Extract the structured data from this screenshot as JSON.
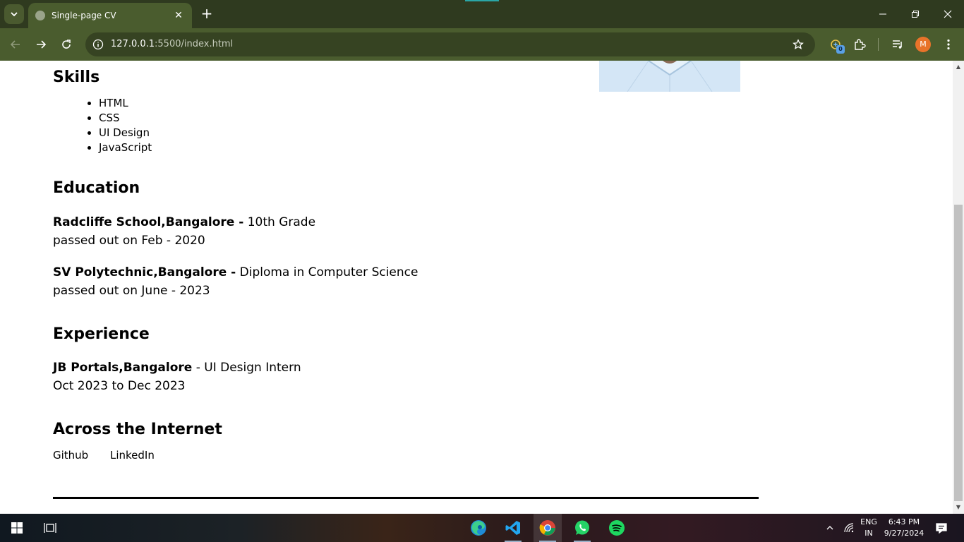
{
  "browser": {
    "tab_title": "Single-page CV",
    "url_host": "127.0.0.1",
    "url_path": ":5500/index.html",
    "profile_initial": "M",
    "extension_badge": "0",
    "accent_color": "#4a5c2e"
  },
  "cv": {
    "skills_heading": "Skills",
    "skills": [
      "HTML",
      "CSS",
      "UI Design",
      "JavaScript"
    ],
    "education_heading": "Education",
    "education": [
      {
        "institution": "Radcliffe School,Bangalore -",
        "detail": "10th Grade",
        "passed": "passed out on Feb - 2020"
      },
      {
        "institution": "SV Polytechnic,Bangalore -",
        "detail": "Diploma in Computer Science",
        "passed": "passed out on June - 2023"
      }
    ],
    "experience_heading": "Experience",
    "experience": [
      {
        "company": "JB Portals,Bangalore",
        "role": "- UI Design Intern",
        "period": "Oct 2023 to Dec 2023"
      }
    ],
    "internet_heading": "Across the Internet",
    "links": [
      "Github",
      "LinkedIn"
    ]
  },
  "taskbar": {
    "language": "ENG",
    "region": "IN",
    "time": "6:43 PM",
    "date": "9/27/2024"
  }
}
